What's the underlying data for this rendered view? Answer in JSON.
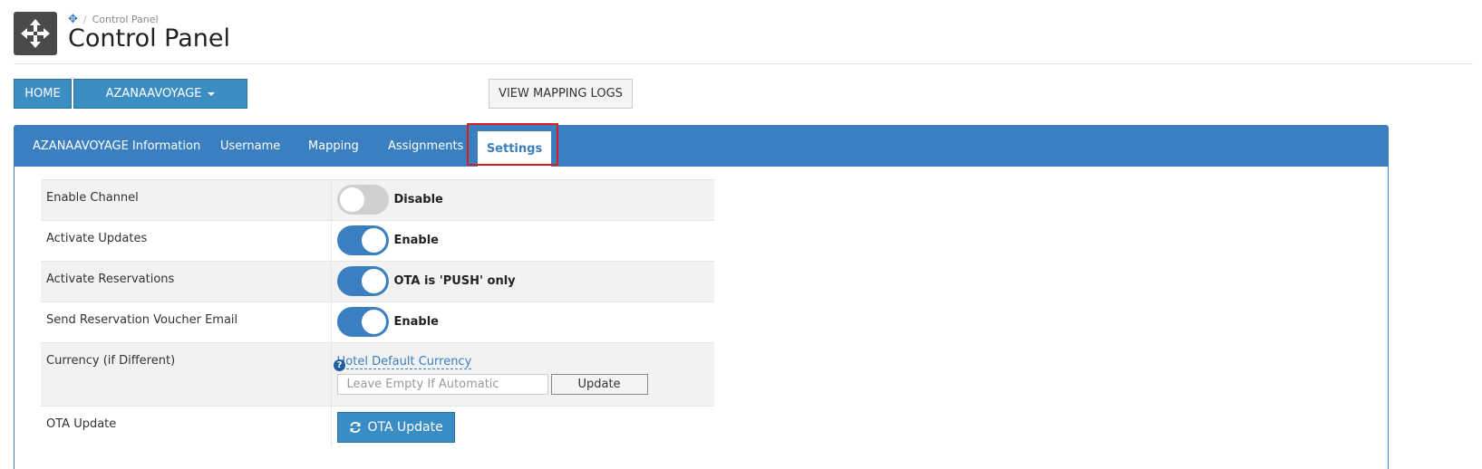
{
  "header": {
    "breadcrumb_label": "Control Panel",
    "breadcrumb_sep": "/",
    "title": "Control Panel",
    "icon": "move-arrows-icon"
  },
  "toolbar": {
    "home_label": "HOME",
    "channel_label": "AZANAAVOYAGE",
    "logs_label": "VIEW MAPPING LOGS"
  },
  "tabs": [
    {
      "label": "AZANAAVOYAGE Information",
      "active": false
    },
    {
      "label": "Username",
      "active": false
    },
    {
      "label": "Mapping",
      "active": false
    },
    {
      "label": "Assignments",
      "active": false
    },
    {
      "label": "Settings",
      "active": true
    }
  ],
  "settings": [
    {
      "label": "Enable Channel",
      "toggle": "off",
      "status": "Disable"
    },
    {
      "label": "Activate Updates",
      "toggle": "on",
      "status": "Enable"
    },
    {
      "label": "Activate Reservations",
      "toggle": "on",
      "status": "OTA is 'PUSH' only"
    },
    {
      "label": "Send Reservation Voucher Email",
      "toggle": "on",
      "status": "Enable"
    }
  ],
  "currency": {
    "label": "Currency (if Different)",
    "help": "?",
    "link": "Hotel Default Currency",
    "placeholder": "Leave Empty If Automatic",
    "button": "Update"
  },
  "ota": {
    "label": "OTA Update",
    "button": "OTA Update"
  },
  "colors": {
    "primary": "#3a7fbf",
    "highlight": "#d61f1f"
  }
}
